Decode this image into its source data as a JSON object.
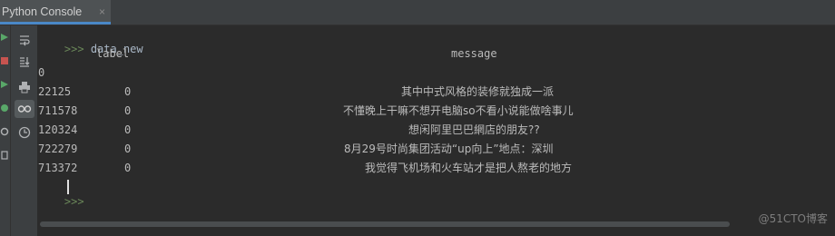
{
  "tab": {
    "title": "Python Console",
    "close_glyph": "×"
  },
  "console": {
    "prompt": ">>>",
    "command": "data_new",
    "header": {
      "label": "label",
      "message": "message"
    },
    "index_label": "0",
    "rows": [
      {
        "index": "22125",
        "label": "0",
        "message": "其中中式风格的装修就独成一派"
      },
      {
        "index": "711578",
        "label": "0",
        "message": "不懂晚上干嘛不想开电脑so不看小说能做啥事儿"
      },
      {
        "index": "120324",
        "label": "0",
        "message": "想闲阿里巴巴網店的朋友??"
      },
      {
        "index": "722279",
        "label": "0",
        "message": "8月29号时尚集团活动“up向上”地点：深圳"
      },
      {
        "index": "713372",
        "label": "0",
        "message": "我觉得飞机场和火车站才是把人熬老的地方"
      }
    ]
  },
  "toolbar": {
    "buttons": [
      "soft-wrap-icon",
      "scroll-to-end-icon",
      "print-icon",
      "show-variables-icon",
      "history-icon"
    ]
  },
  "watermark": "@51CTO博客"
}
